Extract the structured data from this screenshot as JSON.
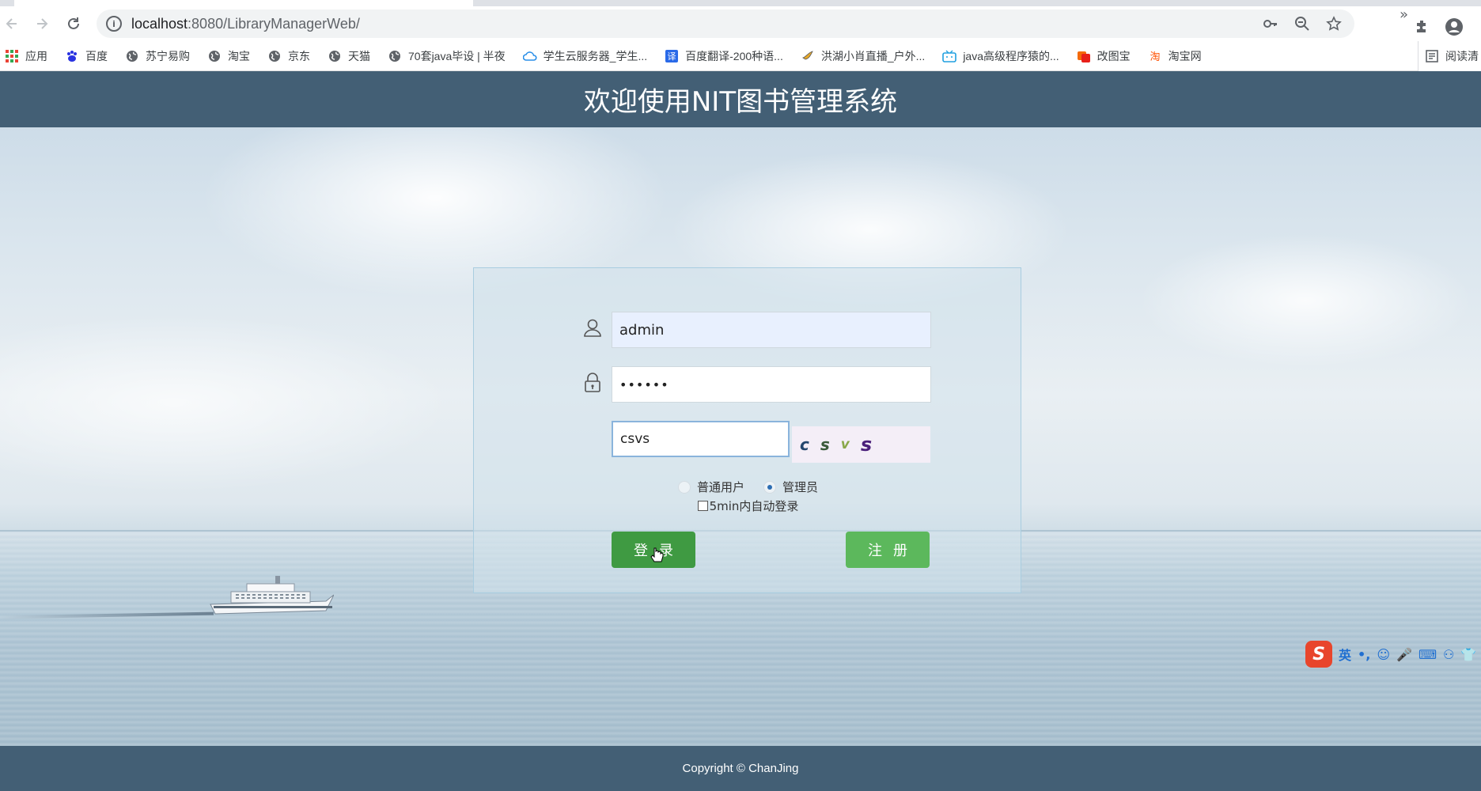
{
  "browser": {
    "url_host": "localhost",
    "url_path": ":8080/LibraryManagerWeb/",
    "bookmarks": [
      {
        "label": "应用",
        "icon": "apps-grid-icon"
      },
      {
        "label": "百度",
        "icon": "baidu-paw-icon"
      },
      {
        "label": "苏宁易购",
        "icon": "globe-icon"
      },
      {
        "label": "淘宝",
        "icon": "globe-icon"
      },
      {
        "label": "京东",
        "icon": "globe-icon"
      },
      {
        "label": "天猫",
        "icon": "globe-icon"
      },
      {
        "label": "70套java毕设 | 半夜",
        "icon": "globe-icon"
      },
      {
        "label": "学生云服务器_学生...",
        "icon": "cloud-icon"
      },
      {
        "label": "百度翻译-200种语...",
        "icon": "translate-icon"
      },
      {
        "label": "洪湖小肖直播_户外...",
        "icon": "bird-icon"
      },
      {
        "label": "java高级程序猿的...",
        "icon": "bilibili-tv-icon"
      },
      {
        "label": "改图宝",
        "icon": "image-edit-icon"
      },
      {
        "label": "淘宝网",
        "icon": "taobao-icon"
      }
    ],
    "bookmarks_more": "»",
    "reading_list": "阅读清"
  },
  "header": {
    "title": "欢迎使用NIT图书管理系统"
  },
  "login": {
    "username_value": "admin",
    "password_value": "••••••",
    "captcha_value": "csvs",
    "captcha_chars": [
      "c",
      "s",
      "v",
      "s"
    ],
    "role_options": [
      {
        "label": "普通用户",
        "selected": false
      },
      {
        "label": "管理员",
        "selected": true
      }
    ],
    "auto_login_label": "5min内自动登录",
    "login_button": "登录",
    "register_button": "注册"
  },
  "footer": {
    "copyright": "Copyright © ChanJing"
  },
  "ime": {
    "mode": "英",
    "punct": "•,"
  },
  "colors": {
    "header_bg": "#435f75",
    "login_btn": "#3f9a42",
    "register_btn": "#5cb85c",
    "radio_selected": "#2c6db3"
  }
}
